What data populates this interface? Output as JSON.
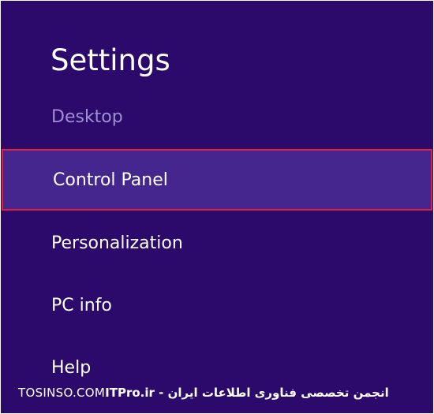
{
  "panel": {
    "title": "Settings",
    "subtitle": "Desktop",
    "items": [
      {
        "label": "Control Panel",
        "selected": true
      },
      {
        "label": "Personalization",
        "selected": false
      },
      {
        "label": "PC info",
        "selected": false
      },
      {
        "label": "Help",
        "selected": false
      }
    ]
  },
  "watermark": {
    "left": "TOSINSO.COM",
    "right": "ITPro.ir - انجمن تخصصی فناوری اطلاعات ایران"
  },
  "colors": {
    "background": "#2b0a6b",
    "selected_background": "#45268f",
    "selected_border": "#e0203a",
    "subtitle": "#9d8fd1"
  }
}
